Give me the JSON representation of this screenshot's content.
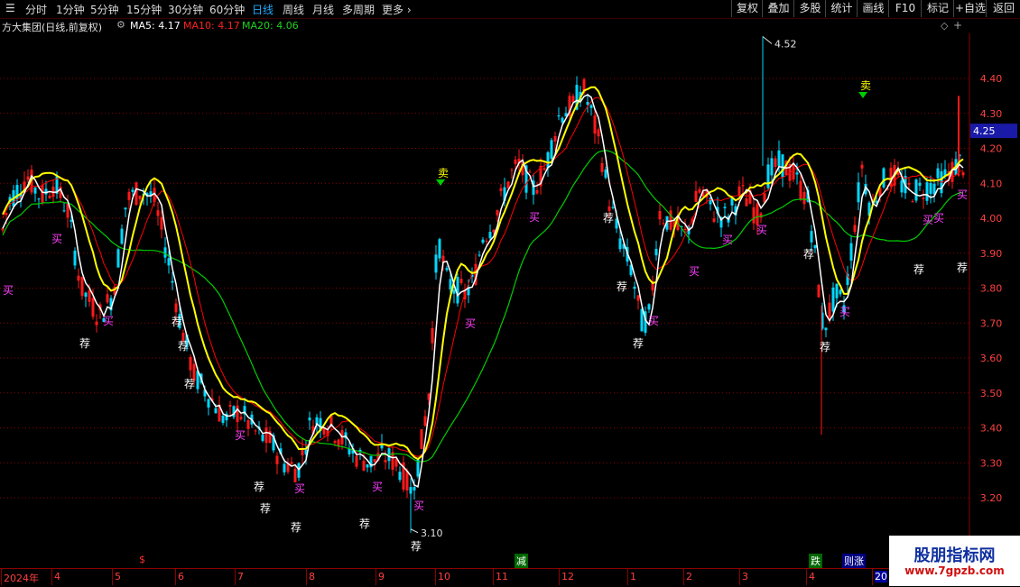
{
  "toolbar": {
    "tabs": [
      {
        "label": "分时",
        "active": false
      },
      {
        "label": "1分钟",
        "active": false
      },
      {
        "label": "5分钟",
        "active": false
      },
      {
        "label": "15分钟",
        "active": false
      },
      {
        "label": "30分钟",
        "active": false
      },
      {
        "label": "60分钟",
        "active": false
      },
      {
        "label": "日线",
        "active": true
      },
      {
        "label": "周线",
        "active": false
      },
      {
        "label": "月线",
        "active": false
      },
      {
        "label": "多周期",
        "active": false
      },
      {
        "label": "更多",
        "active": false
      }
    ],
    "right_buttons": [
      "复权",
      "叠加",
      "多股",
      "统计",
      "画线",
      "F10",
      "标记",
      "+自选",
      "返回"
    ]
  },
  "info": {
    "title": "方大集团(日线,前复权)",
    "ma5": "MA5: 4.17",
    "ma10": "MA10: 4.17",
    "ma20": "MA20: 4.06"
  },
  "colors": {
    "up": "#ff1a1a",
    "down": "#00d8ff",
    "ma5": "#ffffff",
    "ma10": "#ffff00",
    "ma20": "#ff0000",
    "ma_green": "#00cc00",
    "signal_buy": "#ff40ff",
    "signal_rec": "#ffffff",
    "grid": "#8b0000",
    "axis_text": "#ff4040"
  },
  "chart_data": {
    "type": "candlestick",
    "title": "方大集团(日线,前复权)",
    "y_ticks": [
      "4.40",
      "4.30",
      "4.20",
      "4.10",
      "4.00",
      "3.90",
      "3.80",
      "3.70",
      "3.60",
      "3.50",
      "3.40",
      "3.30",
      "3.20"
    ],
    "ylim": [
      3.1,
      4.55
    ],
    "current_price": "4.25",
    "high_marker": {
      "label": "4.52",
      "value": 4.52
    },
    "low_marker": {
      "label": "3.10",
      "value": 3.1
    },
    "x_labels": [
      "2024年",
      "4",
      "5",
      "6",
      "7",
      "8",
      "9",
      "10",
      "11",
      "12",
      "1",
      "2",
      "3",
      "4",
      "20"
    ],
    "x_events": [
      {
        "label": "$",
        "color": "#ff3030"
      },
      {
        "label": "减",
        "color": "#ffffff",
        "bg": "#006600"
      },
      {
        "label": "跌",
        "color": "#ffffff",
        "bg": "#006600"
      },
      {
        "label": "则涨",
        "color": "#ffffff",
        "bg": "#000080"
      }
    ],
    "signals": {
      "sell": "卖",
      "buy": "买",
      "recommend": "荐"
    },
    "series": [
      {
        "name": "MA5",
        "color": "#ffffff"
      },
      {
        "name": "MA10",
        "color": "#ffff00"
      },
      {
        "name": "MA20",
        "color": "#ff0000"
      }
    ]
  },
  "watermark": {
    "line1": "股朋指标网",
    "line2": "www.7gpzb.com"
  }
}
